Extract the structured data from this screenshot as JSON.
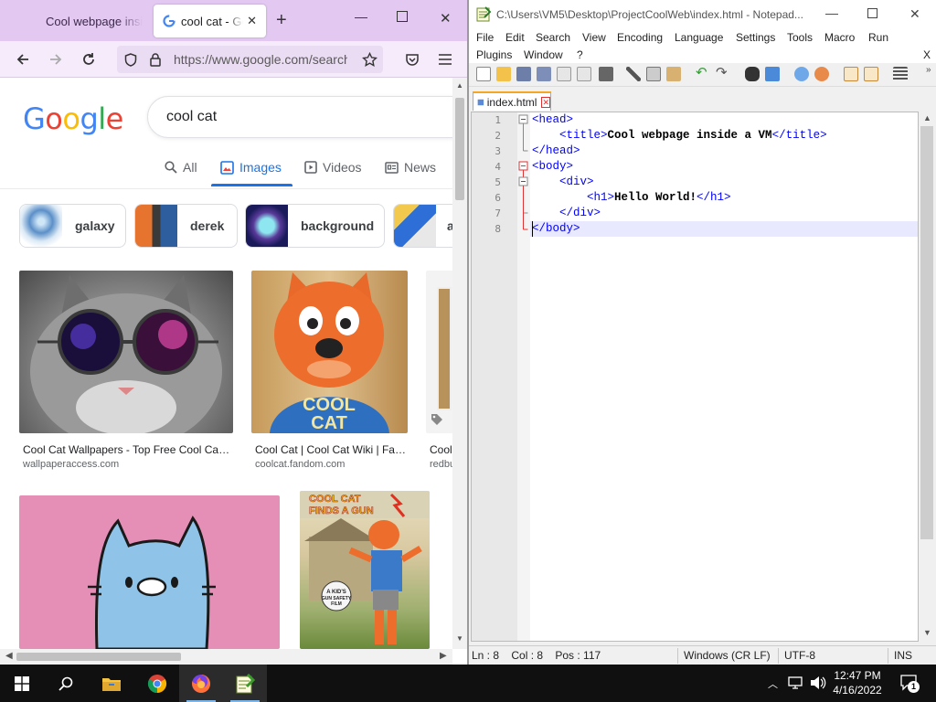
{
  "firefox": {
    "tabs": [
      {
        "title": "Cool webpage inside VM"
      },
      {
        "title": "cool cat - Google Search",
        "active": true
      }
    ],
    "new_tab": "+",
    "window_controls": {
      "minimize": "—",
      "maximize": "☐",
      "close": "✕"
    },
    "url": "https://www.google.com/search?q=cool+cat&tbm=isch",
    "url_display": "https://www.google.com/search"
  },
  "google": {
    "logo_letters": [
      {
        "ch": "G",
        "color": "#4285F4"
      },
      {
        "ch": "o",
        "color": "#EA4335"
      },
      {
        "ch": "o",
        "color": "#FBBC05"
      },
      {
        "ch": "g",
        "color": "#4285F4"
      },
      {
        "ch": "l",
        "color": "#34A853"
      },
      {
        "ch": "e",
        "color": "#EA4335"
      }
    ],
    "query": "cool cat",
    "tabs": [
      {
        "label": "All",
        "icon": "search-icon"
      },
      {
        "label": "Images",
        "icon": "image-icon",
        "active": true
      },
      {
        "label": "Videos",
        "icon": "video-icon"
      },
      {
        "label": "News",
        "icon": "news-icon"
      }
    ],
    "chips": [
      {
        "label": "galaxy"
      },
      {
        "label": "derek"
      },
      {
        "label": "background"
      },
      {
        "label": "a"
      }
    ],
    "results": [
      {
        "caption": "Cool Cat Wallpapers - Top Free Cool Ca…",
        "source": "wallpaperaccess.com"
      },
      {
        "caption": "Cool Cat | Cool Cat Wiki | Fa…",
        "source": "coolcat.fandom.com"
      },
      {
        "caption": "Cool",
        "source": "redbu"
      }
    ],
    "mascot_shirt": "COOL CAT",
    "poster_title": "COOL CAT FINDS A GUN",
    "poster_sign": "A KID'S GUN SAFETY FILM"
  },
  "notepad": {
    "title": "C:\\Users\\VM5\\Desktop\\ProjectCoolWeb\\index.html - Notepad...",
    "menu_row1": [
      "File",
      "Edit",
      "Search",
      "View",
      "Encoding",
      "Language",
      "Settings",
      "Tools",
      "Macro",
      "Run"
    ],
    "menu_row2": [
      "Plugins",
      "Window",
      "?"
    ],
    "menu_close": "X",
    "tab_label": "index.html",
    "lines": [
      {
        "n": "1",
        "indent": "",
        "parts": [
          [
            "tag",
            "<head>"
          ]
        ]
      },
      {
        "n": "2",
        "indent": "    ",
        "parts": [
          [
            "tag",
            "<title>"
          ],
          [
            "txt",
            "Cool webpage inside a VM"
          ],
          [
            "tag",
            "</title>"
          ]
        ]
      },
      {
        "n": "3",
        "indent": "",
        "parts": [
          [
            "tag",
            "</head>"
          ]
        ]
      },
      {
        "n": "4",
        "indent": "",
        "parts": [
          [
            "tag",
            "<body>"
          ]
        ]
      },
      {
        "n": "5",
        "indent": "    ",
        "parts": [
          [
            "tag",
            "<div>"
          ]
        ]
      },
      {
        "n": "6",
        "indent": "        ",
        "parts": [
          [
            "tag",
            "<h1>"
          ],
          [
            "txt",
            "Hello World!"
          ],
          [
            "tag",
            "</h1>"
          ]
        ]
      },
      {
        "n": "7",
        "indent": "    ",
        "parts": [
          [
            "tag",
            "</div>"
          ]
        ]
      },
      {
        "n": "8",
        "indent": "",
        "parts": [
          [
            "tag",
            "</body>"
          ]
        ]
      }
    ],
    "status": {
      "position": "Ln : 8    Col : 8    Pos : 117",
      "eol": "Windows (CR LF)",
      "encoding": "UTF-8",
      "mode": "INS"
    }
  },
  "taskbar": {
    "time": "12:47 PM",
    "date": "4/16/2022",
    "notification_count": "1"
  },
  "colors": {
    "firefox_tabbar": "#e3c8f2",
    "google_blue": "#1a73e8",
    "npp_tag": "#0000ff",
    "taskbar": "#101010"
  }
}
